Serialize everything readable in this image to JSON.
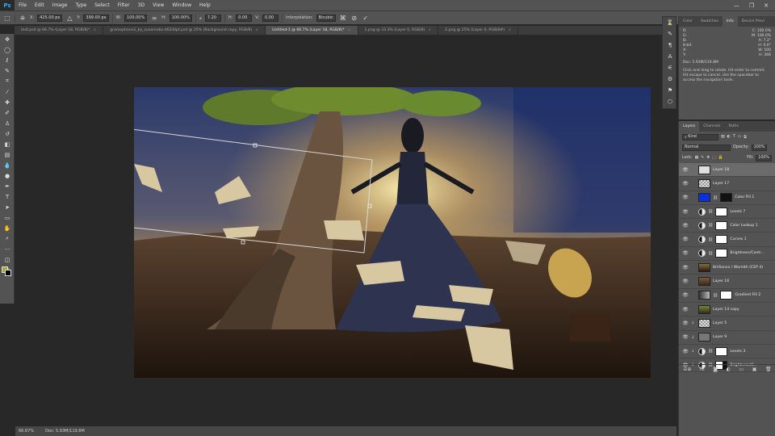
{
  "app": {
    "logo": "Ps"
  },
  "menu": [
    "File",
    "Edit",
    "Image",
    "Type",
    "Select",
    "Filter",
    "3D",
    "View",
    "Window",
    "Help"
  ],
  "window_controls": [
    "—",
    "❐",
    "✕"
  ],
  "options": {
    "x_label": "X:",
    "x_value": "425.00 px",
    "y_label": "Y:",
    "y_value": "399.00 px",
    "w_label": "W:",
    "w_value": "100.00%",
    "h_label": "H:",
    "h_value": "100.00%",
    "angle_label": "⦤",
    "angle_value": "7.20",
    "hskew_label": "H:",
    "hskew_value": "0.00",
    "vskew_label": "V:",
    "vskew_value": "0.00",
    "interp_label": "Interpolation:",
    "interp_value": "Bicubic"
  },
  "tabs": [
    {
      "label": "test.psd @ 66.7% (Layer 18, RGB/8)*",
      "active": false
    },
    {
      "label": "gramophone1_by_susanrebs-d62i0ipt.psd @ 25% (Background copy, RGB/8)",
      "active": false
    },
    {
      "label": "Untitled-1 @ 66.7% (Layer 18, RGB/8)*",
      "active": true
    },
    {
      "label": "1.png @ 33.3% (Layer 0, RGB/8)",
      "active": false
    },
    {
      "label": "2.png @ 25% (Layer 0, RGB/8#)",
      "active": false
    }
  ],
  "status": {
    "zoom": "66.67%",
    "doc": "Doc: 5.93M/119.8M"
  },
  "info_panel": {
    "tabs": [
      "Color",
      "Swatches",
      "Info",
      "Device Previ"
    ],
    "active_tab": "Info",
    "r": "R:",
    "g": "G:",
    "b": "B:",
    "c_label": "C:",
    "c_value": "100.0%",
    "m_label": "M:",
    "m_value": "100.0%",
    "a_label": "A:",
    "a_value": "7.2°",
    "h_label": "H:",
    "h_value": "0.0°",
    "bit": "8-bit",
    "x_label": "X:",
    "y_label": "Y:",
    "w_label": "W:",
    "w_value": "500",
    "hh_label": "H:",
    "hh_value": "366",
    "doc": "Doc: 5.93M/119.8M",
    "tip": "Click and drag to rotate. Hit enter to commit. Hit escape to cancel. Use the spacebar to access the navigation tools."
  },
  "layers_panel": {
    "tabs": [
      "Layers",
      "Channels",
      "Paths"
    ],
    "active_tab": "Layers",
    "kind": "Kind",
    "blend": "Normal",
    "opacity_label": "Opacity:",
    "opacity_value": "100%",
    "lock_label": "Lock:",
    "fill_label": "Fill:",
    "fill_value": "100%",
    "layers": [
      {
        "name": "Layer 18",
        "selected": true,
        "kind": "pixel"
      },
      {
        "name": "Layer 17",
        "selected": false,
        "kind": "pixel"
      },
      {
        "name": "Color Fill 1",
        "selected": false,
        "kind": "fill"
      },
      {
        "name": "Levels 7",
        "selected": false,
        "kind": "adj"
      },
      {
        "name": "Color Lookup 1",
        "selected": false,
        "kind": "adj"
      },
      {
        "name": "Curves 1",
        "selected": false,
        "kind": "adj"
      },
      {
        "name": "Brightness/Contr...",
        "selected": false,
        "kind": "adj"
      },
      {
        "name": "Brilliance / Warmth (CEP 4)",
        "selected": false,
        "kind": "smart"
      },
      {
        "name": "Layer 16",
        "selected": false,
        "kind": "pixel"
      },
      {
        "name": "Gradient Fill 2",
        "selected": false,
        "kind": "grad"
      },
      {
        "name": "Layer 14 copy",
        "selected": false,
        "kind": "pixel"
      },
      {
        "name": "Layer 5",
        "selected": false,
        "kind": "pixel"
      },
      {
        "name": "Layer 9",
        "selected": false,
        "kind": "pixel"
      },
      {
        "name": "Levels 3",
        "selected": false,
        "kind": "adj"
      },
      {
        "name": "Brightness/C...",
        "selected": false,
        "kind": "adj"
      }
    ],
    "footer": [
      "⊖⊕",
      "fx",
      "◙",
      "◐",
      "▭",
      "▣",
      "🗑"
    ]
  }
}
